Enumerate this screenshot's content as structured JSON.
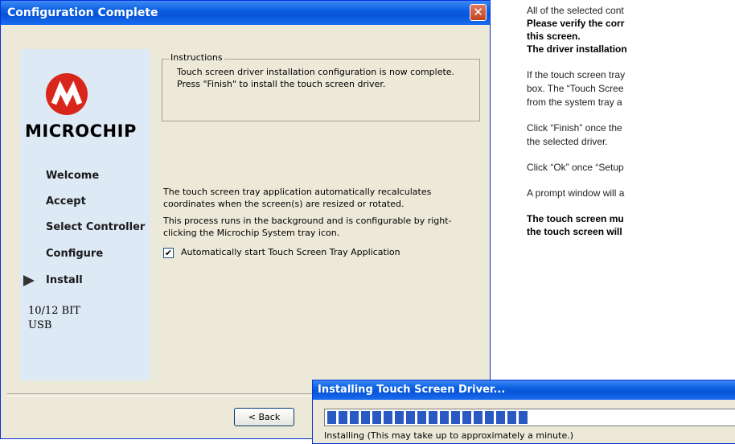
{
  "window": {
    "title": "Configuration Complete",
    "close_glyph": "✕"
  },
  "sidebar": {
    "brand": "MICROCHIP",
    "items": [
      {
        "label": "Welcome"
      },
      {
        "label": "Accept"
      },
      {
        "label": "Select Controller"
      },
      {
        "label": "Configure"
      },
      {
        "label": "Install"
      }
    ],
    "current": "Install",
    "meta1": "10/12 BIT",
    "meta2": "USB"
  },
  "instructions": {
    "legend": "Instructions",
    "text": "Touch screen driver installation configuration is now complete.  Press \"Finish\" to install the touch screen driver."
  },
  "body": {
    "para1": "The touch screen tray application automatically recalculates coordinates when the screen(s) are resized or rotated.",
    "para2": "This process runs in the background and is configurable by right-clicking the Microchip System tray icon.",
    "checkbox_label": "Automatically start Touch Screen Tray Application",
    "checkbox_checked": true
  },
  "buttons": {
    "back_label": "< Back"
  },
  "right_text": [
    {
      "text": "All of the selected cont",
      "bold": false
    },
    {
      "text": "Please verify the corr",
      "bold": true
    },
    {
      "text": "this screen.",
      "bold": true
    },
    {
      "text": "The driver installation",
      "bold": true
    },
    {
      "text": "If the touch screen tray",
      "bold": false
    },
    {
      "text": "box.  The “Touch Scree",
      "bold": false
    },
    {
      "text": "from the system tray a",
      "bold": false
    },
    {
      "text": "Click “Finish” once the",
      "bold": false
    },
    {
      "text": "the selected driver.",
      "bold": false
    },
    {
      "text": "Click “Ok” once “Setup",
      "bold": false
    },
    {
      "text": "A prompt window will a",
      "bold": false
    },
    {
      "text": "The touch screen mu",
      "bold": true
    },
    {
      "text": "the touch screen will",
      "bold": true
    }
  ],
  "progress_dialog": {
    "title": "Installing Touch Screen Driver...",
    "status": "Installing (This may take up to approximately a minute.)",
    "progress_fraction": 0.5
  },
  "colors": {
    "title_bar": "#0a5fe0",
    "progress": "#2b59c3",
    "logo_red": "#d9261c"
  }
}
